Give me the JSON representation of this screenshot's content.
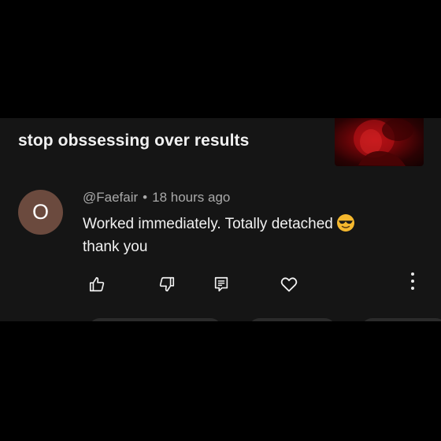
{
  "video": {
    "title": "stop obssessing over results"
  },
  "comment": {
    "avatar_letter": "O",
    "author": "@Faefair",
    "separator": "•",
    "time": "18 hours ago",
    "text_line1": "Worked immediately. Totally detached",
    "text_line2": "thank you",
    "emoji": "sunglasses-emoji"
  },
  "actions": {
    "like_icon": "thumbs-up-icon",
    "dislike_icon": "thumbs-down-icon",
    "reply_icon": "reply-comment-icon",
    "heart_icon": "heart-icon",
    "more_icon": "more-vertical-icon"
  },
  "colors": {
    "background": "#000000",
    "panel": "#151515",
    "avatar": "#6b4a3e",
    "text_primary": "#f1f1f1",
    "text_secondary": "#aaaaaa"
  }
}
